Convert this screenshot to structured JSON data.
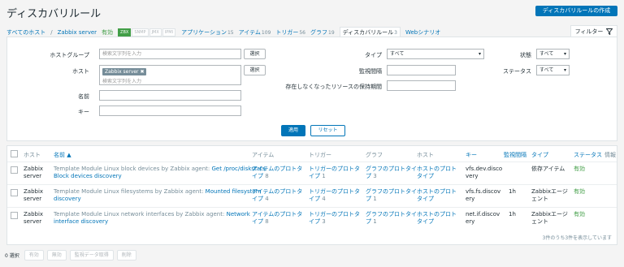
{
  "page": {
    "title": "ディスカバリルール",
    "create_button": "ディスカバリルールの作成"
  },
  "nav": {
    "all_hosts": "すべてのホスト",
    "separator": "/",
    "host": "Zabbix server",
    "status": "有効",
    "tags": [
      "ZBX",
      "SNMP",
      "JMX",
      "IPMI"
    ],
    "applications": {
      "label": "アプリケーション",
      "count": "15"
    },
    "items": {
      "label": "アイテム",
      "count": "109"
    },
    "triggers": {
      "label": "トリガー",
      "count": "56"
    },
    "graphs": {
      "label": "グラフ",
      "count": "19"
    },
    "discovery": {
      "label": "ディスカバリルール",
      "count": "3"
    },
    "web": {
      "label": "Webシナリオ"
    }
  },
  "filter": {
    "tab_label": "フィルター",
    "hostgroup_label": "ホストグループ",
    "hostgroup_placeholder": "検索文字列を入力",
    "select_label": "選択",
    "host_label": "ホスト",
    "host_chip": "Zabbix server",
    "host_placeholder": "検索文字列を入力",
    "name_label": "名前",
    "key_label": "キー",
    "type_label": "タイプ",
    "type_value": "すべて",
    "interval_label": "監視間隔",
    "lost_label": "存在しなくなったリソースの保持期間",
    "state_label": "状態",
    "state_value": "すべて",
    "status_label": "ステータス",
    "status_value": "すべて",
    "apply": "適用",
    "reset": "リセット"
  },
  "table": {
    "headers": {
      "host": "ホスト",
      "name": "名前 ▲",
      "items": "アイテム",
      "triggers": "トリガー",
      "graphs": "グラフ",
      "hosts": "ホスト",
      "key": "キー",
      "interval": "監視間隔",
      "type": "タイプ",
      "status": "ステータス",
      "info": "情報"
    },
    "rows": [
      {
        "host_l1": "Zabbix",
        "host_l2": "server",
        "name_l1a": "Template Module Linux block devices by Zabbix agent: ",
        "name_l1b": "Get /proc/diskstats:",
        "name_l2": "Block devices discovery",
        "items_l1": "アイテムのプロトタ",
        "items_l2": "イプ",
        "items_n": "8",
        "triggers_l1": "トリガーのプロトタ",
        "triggers_l2": "イプ",
        "triggers_n": "1",
        "graphs_l1": "グラフのプロトタイ",
        "graphs_l2": "プ",
        "graphs_n": "3",
        "hosts_l1": "ホストのプロト",
        "hosts_l2": "タイプ",
        "key_l1": "vfs.dev.disco",
        "key_l2": "very",
        "interval": "",
        "type_l1": "依存アイテム",
        "type_l2": "",
        "status": "有効"
      },
      {
        "host_l1": "Zabbix",
        "host_l2": "server",
        "name_l1a": "Template Module Linux filesystems by Zabbix agent: ",
        "name_l1b": "Mounted filesystem",
        "name_l2": "discovery",
        "items_l1": "アイテムのプロトタ",
        "items_l2": "イプ",
        "items_n": "4",
        "triggers_l1": "トリガーのプロトタ",
        "triggers_l2": "イプ",
        "triggers_n": "4",
        "graphs_l1": "グラフのプロトタイ",
        "graphs_l2": "プ",
        "graphs_n": "1",
        "hosts_l1": "ホストのプロト",
        "hosts_l2": "タイプ",
        "key_l1": "vfs.fs.discov",
        "key_l2": "ery",
        "interval": "1h",
        "type_l1": "Zabbixエージ",
        "type_l2": "ェント",
        "status": "有効"
      },
      {
        "host_l1": "Zabbix",
        "host_l2": "server",
        "name_l1a": "Template Module Linux network interfaces by Zabbix agent: ",
        "name_l1b": "Network",
        "name_l2": "interface discovery",
        "items_l1": "アイテムのプロトタ",
        "items_l2": "イプ",
        "items_n": "8",
        "triggers_l1": "トリガーのプロトタ",
        "triggers_l2": "イプ",
        "triggers_n": "3",
        "graphs_l1": "グラフのプロトタイ",
        "graphs_l2": "プ",
        "graphs_n": "1",
        "hosts_l1": "ホストのプロト",
        "hosts_l2": "タイプ",
        "key_l1": "net.if.discov",
        "key_l2": "ery",
        "interval": "1h",
        "type_l1": "Zabbixエージ",
        "type_l2": "ェント",
        "status": "有効"
      }
    ],
    "summary": "3件のうち3件を表示しています"
  },
  "bottom": {
    "selected": "0 選択",
    "buttons": [
      "有効",
      "無効",
      "監視データ取得",
      "削除"
    ]
  },
  "icons": {
    "filter": "filter-funnel-icon",
    "checkbox": "checkbox-icon",
    "dropdown": "chevron-down-icon"
  }
}
